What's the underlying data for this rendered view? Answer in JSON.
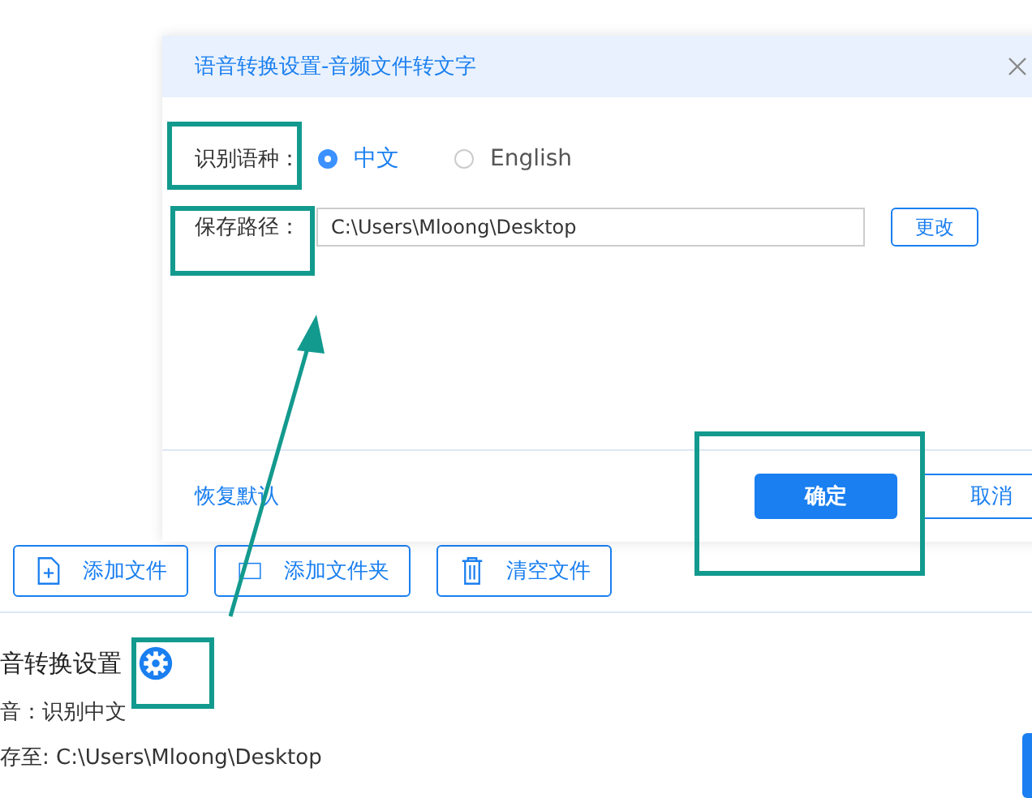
{
  "toolbar": [
    {
      "label": "添加文件"
    },
    {
      "label": "添加文件夹"
    },
    {
      "label": "清空文件"
    }
  ],
  "settings": {
    "title": "音转换设置",
    "lines": [
      "音：识别中文",
      "存至: C:\\Users\\Mloong\\Desktop"
    ]
  },
  "dialog": {
    "title": "语音转换设置-音频文件转文字",
    "fields": [
      {
        "kind": "radio",
        "label": "识别语种：",
        "options": [
          {
            "label": "中文",
            "selected": true
          },
          {
            "label": "English",
            "selected": false
          }
        ]
      },
      {
        "kind": "path",
        "label": "保存路径：",
        "value": "C:\\Users\\Mloong\\Desktop",
        "button": "更改"
      }
    ],
    "reset_link": "恢复默认",
    "buttons": [
      {
        "label": "确定",
        "primary": true
      },
      {
        "label": "取消",
        "primary": false
      }
    ]
  }
}
